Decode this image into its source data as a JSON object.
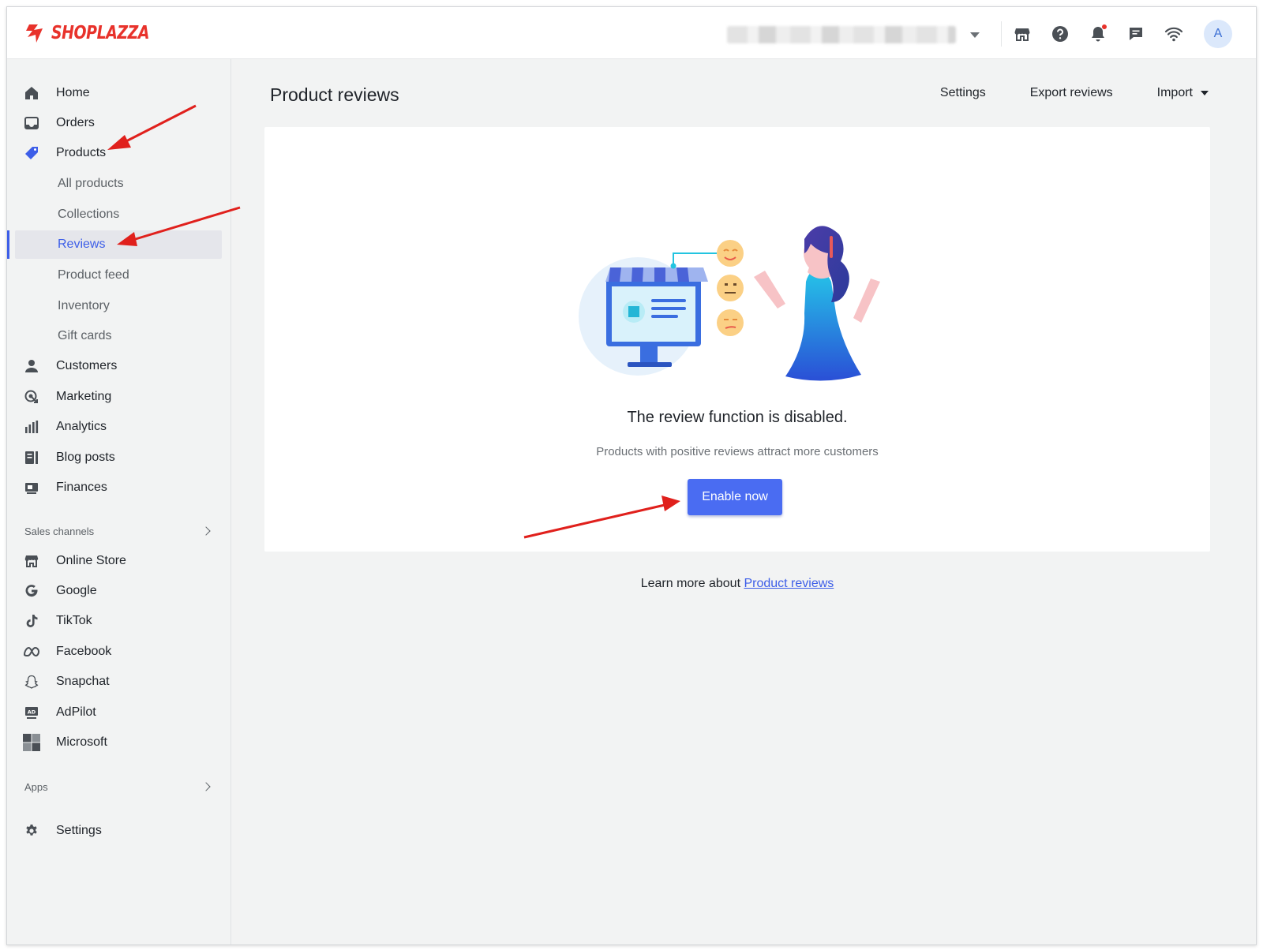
{
  "app": {
    "brand": "SHOPLAZZA",
    "brand_color": "#e8322b",
    "accent_color": "#4a6cf2"
  },
  "topbar": {
    "store_selector_state": "blurred",
    "icons": [
      "storefront-icon",
      "help-icon",
      "bell-icon",
      "chat-icon",
      "wifi-icon"
    ],
    "avatar_letter": "A"
  },
  "sidebar": {
    "items": [
      {
        "label": "Home",
        "icon": "home-icon"
      },
      {
        "label": "Orders",
        "icon": "inbox-icon"
      },
      {
        "label": "Products",
        "icon": "tag-icon"
      },
      {
        "label": "All products"
      },
      {
        "label": "Collections"
      },
      {
        "label": "Reviews",
        "active": true
      },
      {
        "label": "Product feed"
      },
      {
        "label": "Inventory"
      },
      {
        "label": "Gift cards"
      },
      {
        "label": "Customers",
        "icon": "person-icon"
      },
      {
        "label": "Marketing",
        "icon": "target-icon"
      },
      {
        "label": "Analytics",
        "icon": "bar-chart-icon"
      },
      {
        "label": "Blog posts",
        "icon": "blog-icon"
      },
      {
        "label": "Finances",
        "icon": "finance-icon"
      }
    ],
    "sales_channels": {
      "heading": "Sales channels",
      "items": [
        {
          "label": "Online Store",
          "icon": "storefront-icon"
        },
        {
          "label": "Google",
          "icon": "google-icon"
        },
        {
          "label": "TikTok",
          "icon": "tiktok-icon"
        },
        {
          "label": "Facebook",
          "icon": "meta-icon"
        },
        {
          "label": "Snapchat",
          "icon": "snapchat-icon"
        },
        {
          "label": "AdPilot",
          "icon": "ad-icon"
        },
        {
          "label": "Microsoft",
          "icon": "microsoft-icon"
        }
      ]
    },
    "apps": {
      "heading": "Apps"
    },
    "settings": {
      "label": "Settings",
      "icon": "gear-icon"
    }
  },
  "main": {
    "title": "Product reviews",
    "actions": {
      "settings": "Settings",
      "export": "Export reviews",
      "import": "Import"
    },
    "empty_state": {
      "title": "The review function is disabled.",
      "subtitle": "Products with positive reviews attract more customers",
      "button": "Enable now"
    },
    "learn_more": {
      "prefix": "Learn more about",
      "link": "Product reviews"
    }
  }
}
